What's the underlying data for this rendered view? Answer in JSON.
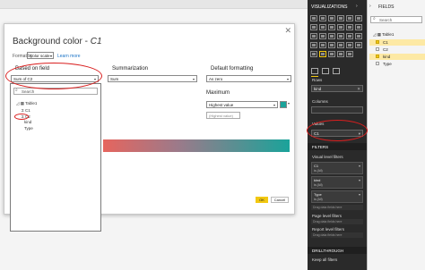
{
  "dialog": {
    "title": "Background color - ",
    "title_field": "C1",
    "format_by_label": "Format by",
    "format_by_value": "Color scale",
    "learn_more": "Learn more",
    "based_on_field_label": "Based on field",
    "based_on_field_value": "Sum of C2",
    "summarization_label": "Summarization",
    "summarization_value": "Sum",
    "default_formatting_label": "Default formatting",
    "default_formatting_value": "As zero",
    "maximum_label": "Maximum",
    "maximum_value": "Highest value",
    "maximum_input": "(Highest value)",
    "maximum_color": "#1aa39a",
    "ok_label": "OK",
    "cancel_label": "Cancel"
  },
  "dropdown": {
    "search_placeholder": "Search",
    "tree": {
      "table": "Table1",
      "items": [
        "C1",
        "C2",
        "kind",
        "Type"
      ]
    }
  },
  "viz_panel": {
    "title": "VISUALIZATIONS",
    "rows_label": "Rows",
    "rows_value": "kind",
    "columns_label": "Columns",
    "values_label": "Values",
    "values_value": "C1",
    "filters_title": "FILTERS",
    "visual_level_filters": "Visual level filters",
    "filters": [
      {
        "name": "C1",
        "state": "is (All)"
      },
      {
        "name": "kind",
        "state": "is (All)"
      },
      {
        "name": "Type",
        "state": "is (All)"
      }
    ],
    "drag_here": "Drag data fields here",
    "page_level_filters": "Page level filters",
    "report_level_filters": "Report level filters",
    "drillthrough_title": "DRILLTHROUGH",
    "keep_all_filters": "Keep all filters"
  },
  "fields_panel": {
    "title": "FIELDS",
    "search_placeholder": "Search",
    "table": "Table1",
    "fields": [
      "C1",
      "C2",
      "kind",
      "Type"
    ]
  },
  "colors": {
    "accent": "#f2c811",
    "annotation_red": "#d91e1e",
    "gradient_min": "#e6655e",
    "gradient_max": "#1aa39a"
  }
}
